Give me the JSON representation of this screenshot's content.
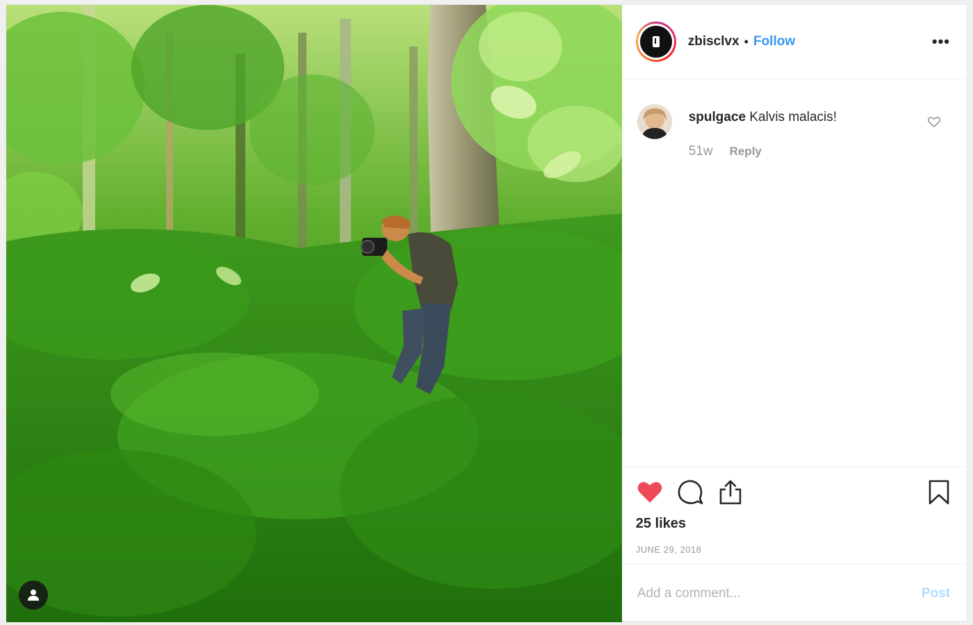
{
  "header": {
    "username": "zbisclvx",
    "separator": "•",
    "follow_label": "Follow",
    "more_label": "•••"
  },
  "comments": [
    {
      "username": "spulgace",
      "text": "Kalvis malacis!",
      "time": "51w",
      "reply_label": "Reply"
    }
  ],
  "post": {
    "likes": "25 likes",
    "date": "JUNE 29, 2018",
    "liked": true,
    "like_color": "#ed4956"
  },
  "add_comment": {
    "placeholder": "Add a comment...",
    "post_label": "Post"
  },
  "colors": {
    "link": "#3897f0",
    "post_disabled": "#b3dbff"
  }
}
